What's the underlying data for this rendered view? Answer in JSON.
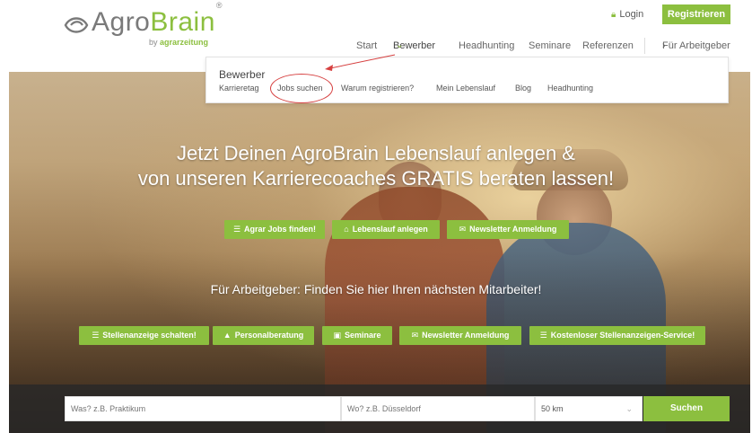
{
  "header": {
    "logo_agro": "Agro",
    "logo_brain": "Brain",
    "logo_reg": "®",
    "logo_by": "by",
    "logo_by_brand": "agrarzeitung",
    "login_label": "Login",
    "register_label": "Registrieren"
  },
  "nav": {
    "items": [
      "Start",
      "Bewerber",
      "Headhunting",
      "Seminare",
      "Referenzen",
      "Für Arbeitgeber"
    ]
  },
  "dropdown": {
    "title": "Bewerber",
    "links": [
      "Karrieretag",
      "Jobs suchen",
      "Warum registrieren?",
      "Mein Lebenslauf",
      "Blog",
      "Headhunting"
    ]
  },
  "hero": {
    "headline_line1": "Jetzt Deinen AgroBrain Lebenslauf anlegen &",
    "headline_line2": "von unseren Karrierecoaches GRATIS beraten lassen!",
    "candidate_buttons": [
      "Agrar Jobs finden!",
      "Lebenslauf anlegen",
      "Newsletter Anmeldung"
    ],
    "employer_headline": "Für Arbeitgeber: Finden Sie hier Ihren nächsten Mitarbeiter!",
    "employer_buttons": [
      "Stellenanzeige schalten!",
      "Personalberatung",
      "Seminare",
      "Newsletter Anmeldung",
      "Kostenloser Stellenanzeigen-Service!"
    ]
  },
  "search": {
    "what_placeholder": "Was? z.B. Praktikum",
    "where_placeholder": "Wo? z.B. Düsseldorf",
    "radius_value": "50 km",
    "submit_label": "Suchen"
  },
  "colors": {
    "accent": "#8cbf3f",
    "annotation": "#d64040"
  }
}
